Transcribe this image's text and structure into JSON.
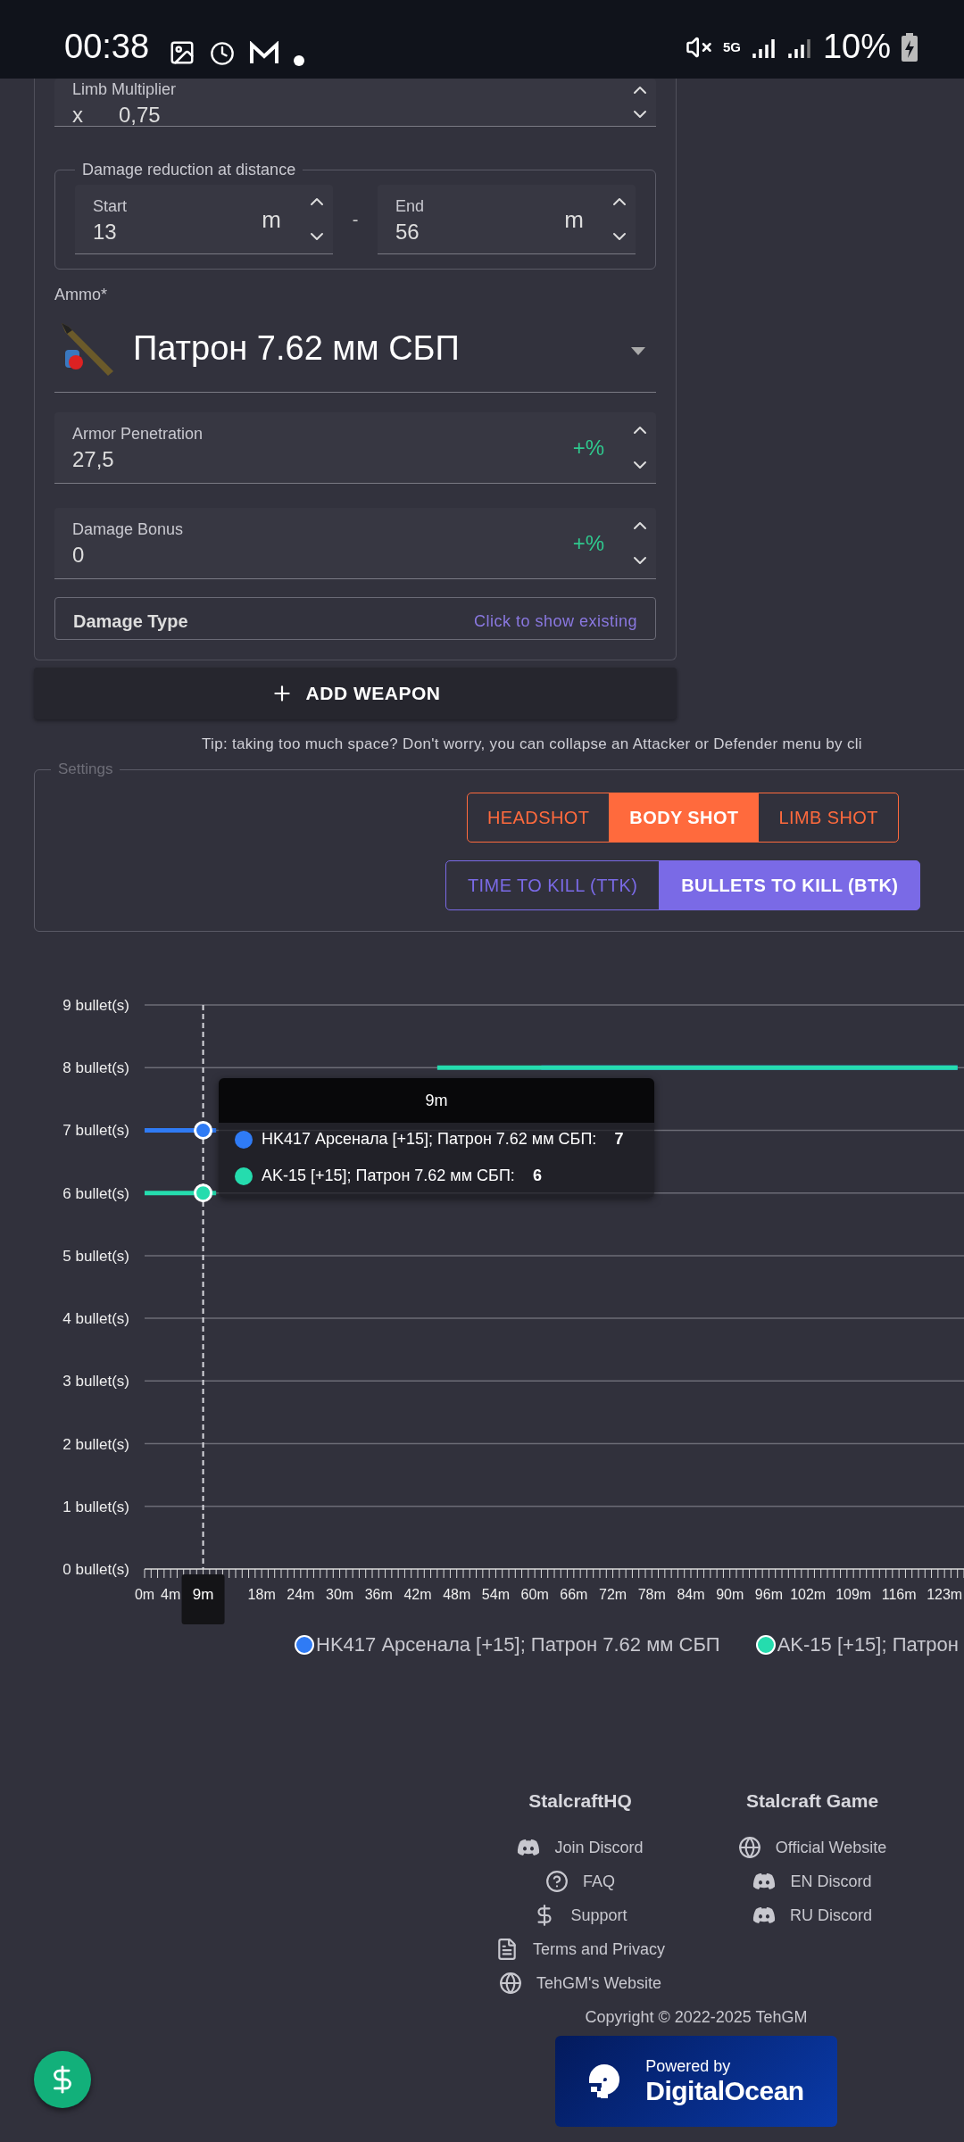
{
  "status_bar": {
    "time": "00:38",
    "network": "5G",
    "battery": "10%"
  },
  "weapon_form": {
    "limb_multiplier": {
      "label": "Limb Multiplier",
      "prefix": "x",
      "value": "0,75"
    },
    "damage_reduction": {
      "legend": "Damage reduction at distance",
      "separator": "-",
      "start": {
        "label": "Start",
        "value": "13",
        "unit": "m"
      },
      "end": {
        "label": "End",
        "value": "56",
        "unit": "m"
      }
    },
    "ammo": {
      "label": "Ammo*",
      "value": "Патрон 7.62 мм СБП"
    },
    "armor_penetration": {
      "label": "Armor Penetration",
      "value": "27,5",
      "suffix": "+%"
    },
    "damage_bonus": {
      "label": "Damage Bonus",
      "value": "0",
      "suffix": "+%"
    },
    "damage_type": {
      "label": "Damage Type",
      "action": "Click to show existing"
    }
  },
  "add_weapon_button": "ADD WEAPON",
  "tip": "Tip: taking too much space? Don't worry, you can collapse an Attacker or Defender menu by cli",
  "settings": {
    "legend": "Settings",
    "shot_types": [
      {
        "label": "HEADSHOT",
        "selected": false
      },
      {
        "label": "BODY SHOT",
        "selected": true
      },
      {
        "label": "LIMB SHOT",
        "selected": false
      }
    ],
    "modes": [
      {
        "label": "TIME TO KILL (TTK)",
        "selected": false
      },
      {
        "label": "BULLETS TO KILL (BTK)",
        "selected": true
      }
    ]
  },
  "chart": {
    "chart_data": {
      "type": "line",
      "grid": true,
      "x": [
        0,
        9,
        11,
        20,
        21,
        44,
        45,
        60,
        61,
        125
      ],
      "xlim": [
        0,
        126
      ],
      "ylim": [
        0,
        9
      ],
      "ref_lines": [
        {
          "axis": "x",
          "value": 9
        }
      ],
      "series": [
        {
          "name": "HK417 Арсенала [+15]; Патрон 7.62 мм СБП",
          "color": "#2f7bf5",
          "values": [
            7,
            7,
            7,
            null,
            null,
            null,
            null,
            null,
            8,
            8
          ]
        },
        {
          "name": "AK-15 [+15]; Патрон 7.62 мм СБП",
          "color": "#25dcae",
          "values": [
            6,
            6,
            6,
            null,
            null,
            null,
            8,
            8,
            8,
            8
          ]
        }
      ],
      "xticks": [
        {
          "value": 0,
          "label": "0m"
        },
        {
          "value": 4,
          "label": "4m"
        },
        {
          "value": 18,
          "label": "18m"
        },
        {
          "value": 24,
          "label": "24m"
        },
        {
          "value": 30,
          "label": "30m"
        },
        {
          "value": 36,
          "label": "36m"
        },
        {
          "value": 42,
          "label": "42m"
        },
        {
          "value": 48,
          "label": "48m"
        },
        {
          "value": 54,
          "label": "54m"
        },
        {
          "value": 60,
          "label": "60m"
        },
        {
          "value": 66,
          "label": "66m"
        },
        {
          "value": 72,
          "label": "72m"
        },
        {
          "value": 78,
          "label": "78m"
        },
        {
          "value": 84,
          "label": "84m"
        },
        {
          "value": 90,
          "label": "90m"
        },
        {
          "value": 96,
          "label": "96m"
        },
        {
          "value": 102,
          "label": "102m"
        },
        {
          "value": 109,
          "label": "109m"
        },
        {
          "value": 116,
          "label": "116m"
        },
        {
          "value": 123,
          "label": "123m"
        }
      ],
      "yticks": [
        {
          "value": 0,
          "label": "0 bullet(s)"
        },
        {
          "value": 1,
          "label": "1 bullet(s)"
        },
        {
          "value": 2,
          "label": "2 bullet(s)"
        },
        {
          "value": 3,
          "label": "3 bullet(s)"
        },
        {
          "value": 4,
          "label": "4 bullet(s)"
        },
        {
          "value": 5,
          "label": "5 bullet(s)"
        },
        {
          "value": 6,
          "label": "6 bullet(s)"
        },
        {
          "value": 7,
          "label": "7 bullet(s)"
        },
        {
          "value": 8,
          "label": "8 bullet(s)"
        },
        {
          "value": 9,
          "label": "9 bullet(s)"
        }
      ]
    },
    "hover": {
      "x_label": "9m",
      "tooltip": {
        "title": "9m",
        "separator": ":",
        "items": [
          {
            "value": "7"
          },
          {
            "value": "6"
          }
        ]
      }
    },
    "legend": [
      {
        "label": "HK417 Арсенала [+15]; Патрон 7.62 мм СБП",
        "color": "#2f7bf5"
      },
      {
        "label": "AK-15 [+15]; Патрон",
        "color": "#25dcae"
      }
    ]
  },
  "footer": {
    "columns": [
      {
        "title": "StalcraftHQ",
        "links": [
          {
            "label": "Join Discord",
            "kind": "discord"
          },
          {
            "label": "FAQ",
            "kind": "faq"
          },
          {
            "label": "Support",
            "kind": "support"
          },
          {
            "label": "Terms and Privacy",
            "kind": "document"
          },
          {
            "label": "TehGM's Website",
            "kind": "globe"
          }
        ]
      },
      {
        "title": "Stalcraft Game",
        "links": [
          {
            "label": "Official Website",
            "kind": "globe"
          },
          {
            "label": "EN Discord",
            "kind": "discord"
          },
          {
            "label": "RU Discord",
            "kind": "discord"
          }
        ]
      }
    ],
    "copyright": "Copyright © 2022-2025 TehGM",
    "badge": {
      "line_1": "Powered by",
      "line_2": "DigitalOcean"
    }
  }
}
